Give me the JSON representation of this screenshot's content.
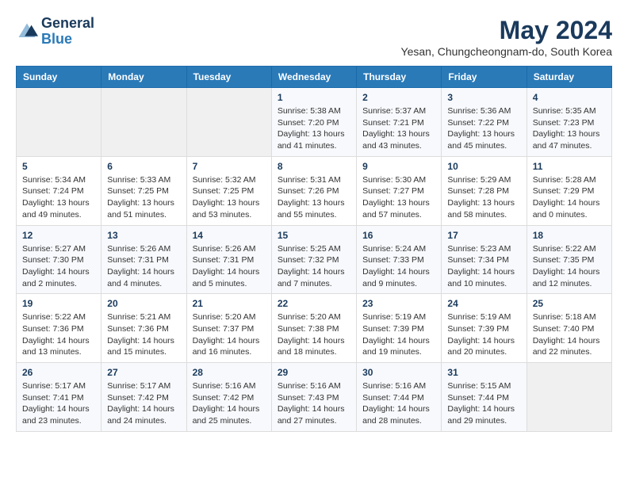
{
  "logo": {
    "line1": "General",
    "line2": "Blue"
  },
  "title": "May 2024",
  "location": "Yesan, Chungcheongnam-do, South Korea",
  "weekdays": [
    "Sunday",
    "Monday",
    "Tuesday",
    "Wednesday",
    "Thursday",
    "Friday",
    "Saturday"
  ],
  "weeks": [
    [
      {
        "day": "",
        "detail": ""
      },
      {
        "day": "",
        "detail": ""
      },
      {
        "day": "",
        "detail": ""
      },
      {
        "day": "1",
        "detail": "Sunrise: 5:38 AM\nSunset: 7:20 PM\nDaylight: 13 hours\nand 41 minutes."
      },
      {
        "day": "2",
        "detail": "Sunrise: 5:37 AM\nSunset: 7:21 PM\nDaylight: 13 hours\nand 43 minutes."
      },
      {
        "day": "3",
        "detail": "Sunrise: 5:36 AM\nSunset: 7:22 PM\nDaylight: 13 hours\nand 45 minutes."
      },
      {
        "day": "4",
        "detail": "Sunrise: 5:35 AM\nSunset: 7:23 PM\nDaylight: 13 hours\nand 47 minutes."
      }
    ],
    [
      {
        "day": "5",
        "detail": "Sunrise: 5:34 AM\nSunset: 7:24 PM\nDaylight: 13 hours\nand 49 minutes."
      },
      {
        "day": "6",
        "detail": "Sunrise: 5:33 AM\nSunset: 7:25 PM\nDaylight: 13 hours\nand 51 minutes."
      },
      {
        "day": "7",
        "detail": "Sunrise: 5:32 AM\nSunset: 7:25 PM\nDaylight: 13 hours\nand 53 minutes."
      },
      {
        "day": "8",
        "detail": "Sunrise: 5:31 AM\nSunset: 7:26 PM\nDaylight: 13 hours\nand 55 minutes."
      },
      {
        "day": "9",
        "detail": "Sunrise: 5:30 AM\nSunset: 7:27 PM\nDaylight: 13 hours\nand 57 minutes."
      },
      {
        "day": "10",
        "detail": "Sunrise: 5:29 AM\nSunset: 7:28 PM\nDaylight: 13 hours\nand 58 minutes."
      },
      {
        "day": "11",
        "detail": "Sunrise: 5:28 AM\nSunset: 7:29 PM\nDaylight: 14 hours\nand 0 minutes."
      }
    ],
    [
      {
        "day": "12",
        "detail": "Sunrise: 5:27 AM\nSunset: 7:30 PM\nDaylight: 14 hours\nand 2 minutes."
      },
      {
        "day": "13",
        "detail": "Sunrise: 5:26 AM\nSunset: 7:31 PM\nDaylight: 14 hours\nand 4 minutes."
      },
      {
        "day": "14",
        "detail": "Sunrise: 5:26 AM\nSunset: 7:31 PM\nDaylight: 14 hours\nand 5 minutes."
      },
      {
        "day": "15",
        "detail": "Sunrise: 5:25 AM\nSunset: 7:32 PM\nDaylight: 14 hours\nand 7 minutes."
      },
      {
        "day": "16",
        "detail": "Sunrise: 5:24 AM\nSunset: 7:33 PM\nDaylight: 14 hours\nand 9 minutes."
      },
      {
        "day": "17",
        "detail": "Sunrise: 5:23 AM\nSunset: 7:34 PM\nDaylight: 14 hours\nand 10 minutes."
      },
      {
        "day": "18",
        "detail": "Sunrise: 5:22 AM\nSunset: 7:35 PM\nDaylight: 14 hours\nand 12 minutes."
      }
    ],
    [
      {
        "day": "19",
        "detail": "Sunrise: 5:22 AM\nSunset: 7:36 PM\nDaylight: 14 hours\nand 13 minutes."
      },
      {
        "day": "20",
        "detail": "Sunrise: 5:21 AM\nSunset: 7:36 PM\nDaylight: 14 hours\nand 15 minutes."
      },
      {
        "day": "21",
        "detail": "Sunrise: 5:20 AM\nSunset: 7:37 PM\nDaylight: 14 hours\nand 16 minutes."
      },
      {
        "day": "22",
        "detail": "Sunrise: 5:20 AM\nSunset: 7:38 PM\nDaylight: 14 hours\nand 18 minutes."
      },
      {
        "day": "23",
        "detail": "Sunrise: 5:19 AM\nSunset: 7:39 PM\nDaylight: 14 hours\nand 19 minutes."
      },
      {
        "day": "24",
        "detail": "Sunrise: 5:19 AM\nSunset: 7:39 PM\nDaylight: 14 hours\nand 20 minutes."
      },
      {
        "day": "25",
        "detail": "Sunrise: 5:18 AM\nSunset: 7:40 PM\nDaylight: 14 hours\nand 22 minutes."
      }
    ],
    [
      {
        "day": "26",
        "detail": "Sunrise: 5:17 AM\nSunset: 7:41 PM\nDaylight: 14 hours\nand 23 minutes."
      },
      {
        "day": "27",
        "detail": "Sunrise: 5:17 AM\nSunset: 7:42 PM\nDaylight: 14 hours\nand 24 minutes."
      },
      {
        "day": "28",
        "detail": "Sunrise: 5:16 AM\nSunset: 7:42 PM\nDaylight: 14 hours\nand 25 minutes."
      },
      {
        "day": "29",
        "detail": "Sunrise: 5:16 AM\nSunset: 7:43 PM\nDaylight: 14 hours\nand 27 minutes."
      },
      {
        "day": "30",
        "detail": "Sunrise: 5:16 AM\nSunset: 7:44 PM\nDaylight: 14 hours\nand 28 minutes."
      },
      {
        "day": "31",
        "detail": "Sunrise: 5:15 AM\nSunset: 7:44 PM\nDaylight: 14 hours\nand 29 minutes."
      },
      {
        "day": "",
        "detail": ""
      }
    ]
  ]
}
